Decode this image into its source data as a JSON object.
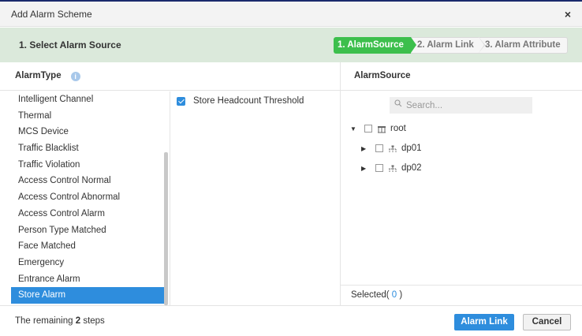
{
  "dialog": {
    "title": "Add Alarm Scheme",
    "close_label": "×"
  },
  "stepbar": {
    "current_step_title": "1.   Select Alarm Source",
    "steps": [
      {
        "label": "1. AlarmSource",
        "active": true
      },
      {
        "label": "2. Alarm Link",
        "active": false
      },
      {
        "label": "3. Alarm Attribute",
        "active": false
      }
    ]
  },
  "alarm_type": {
    "header": "AlarmType",
    "info_icon": "i",
    "items": [
      {
        "label": "Intelligent Channel"
      },
      {
        "label": "Thermal"
      },
      {
        "label": "MCS Device"
      },
      {
        "label": "Traffic Blacklist"
      },
      {
        "label": "Traffic Violation"
      },
      {
        "label": "Access Control Normal"
      },
      {
        "label": "Access Control Abnormal"
      },
      {
        "label": "Access Control Alarm"
      },
      {
        "label": "Person Type Matched"
      },
      {
        "label": "Face Matched"
      },
      {
        "label": "Emergency"
      },
      {
        "label": "Entrance Alarm"
      },
      {
        "label": "Store Alarm",
        "selected": true
      }
    ]
  },
  "alarm_list": {
    "items": [
      {
        "label": "Store Headcount Threshold",
        "checked": true
      }
    ]
  },
  "alarm_source": {
    "header": "AlarmSource",
    "search_placeholder": "Search...",
    "search_icon": "search-icon",
    "tree": [
      {
        "label": "root",
        "expanded": true,
        "icon": "root-org-icon",
        "caret": "▼"
      },
      {
        "label": "dp01",
        "expanded": false,
        "icon": "department-icon",
        "caret": "▶"
      },
      {
        "label": "dp02",
        "expanded": false,
        "icon": "department-icon",
        "caret": "▶"
      }
    ],
    "selected_label": "Selected(",
    "selected_count": " 0 ",
    "selected_close": ")"
  },
  "footer": {
    "remaining_prefix": "The remaining ",
    "remaining_count": "2",
    "remaining_suffix": " steps",
    "primary_button": "Alarm Link",
    "cancel_button": "Cancel"
  },
  "colors": {
    "accent": "#2e8ddd",
    "step_active": "#3cbf4c",
    "stepbar_bg": "#dbe9db"
  }
}
